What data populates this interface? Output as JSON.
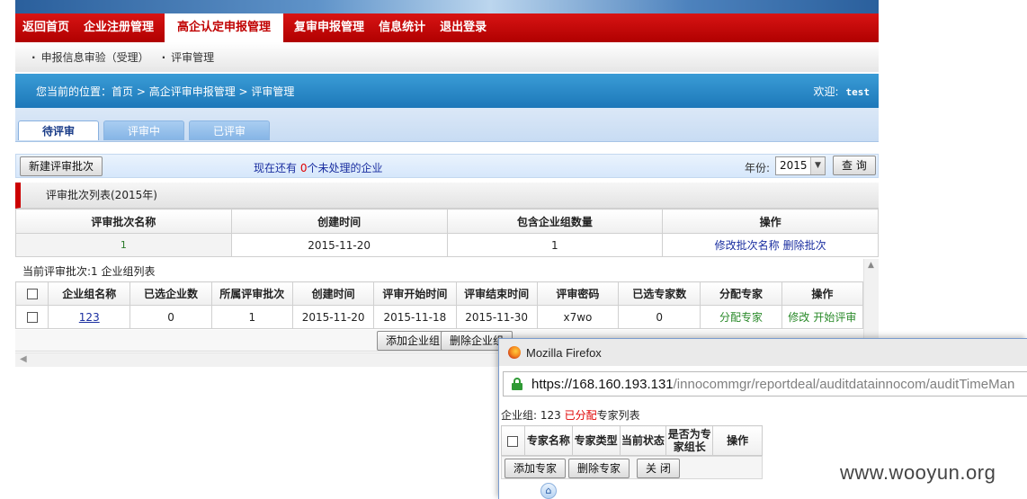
{
  "nav": {
    "items": [
      {
        "label": "返回首页",
        "active": false
      },
      {
        "label": "企业注册管理",
        "active": false
      },
      {
        "label": "高企认定申报管理",
        "active": true
      },
      {
        "label": "复审申报管理",
        "active": false
      },
      {
        "label": "信息统计",
        "active": false
      },
      {
        "label": "退出登录",
        "active": false
      }
    ],
    "sub_items": [
      "申报信息审验（受理）",
      "评审管理"
    ]
  },
  "location": {
    "prefix": "您当前的位置：",
    "crumbs": [
      "首页",
      "高企评审申报管理",
      "评审管理"
    ],
    "separator": " > ",
    "welcome_label": "欢迎:",
    "username": "test"
  },
  "tabs": [
    "待评审",
    "评审中",
    "已评审"
  ],
  "toolbar": {
    "new_batch_label": "新建评审批次",
    "pending_prefix": "现在还有 ",
    "pending_count": "0",
    "pending_suffix": "个未处理的企业",
    "year_label": "年份:",
    "year_value": "2015",
    "query_label": "查 询"
  },
  "batch": {
    "title": "评审批次列表(2015年)",
    "headers": [
      "评审批次名称",
      "创建时间",
      "包含企业组数量",
      "操作"
    ],
    "rows": [
      {
        "name": "1",
        "created": "2015-11-20",
        "group_count": "1",
        "op1": "修改批次名称",
        "op2": "删除批次"
      }
    ]
  },
  "groups": {
    "caption": "当前评审批次:1  企业组列表",
    "headers": [
      "企业组名称",
      "已选企业数",
      "所属评审批次",
      "创建时间",
      "评审开始时间",
      "评审结束时间",
      "评审密码",
      "已选专家数",
      "分配专家",
      "操作"
    ],
    "rows": [
      {
        "name": "123",
        "selected": "0",
        "batch": "1",
        "created": "2015-11-20",
        "start": "2015-11-18",
        "end": "2015-11-30",
        "password": "x7wo",
        "experts": "0",
        "assign": "分配专家",
        "op1": "修改",
        "op2": "开始评审"
      }
    ],
    "add_label": "添加企业组",
    "delete_label": "删除企业组"
  },
  "popup": {
    "window_title": "Mozilla Firefox",
    "url_host": "https://168.160.193.131",
    "url_path": "/innocommgr/reportdeal/auditdatainnocom/auditTimeMan",
    "caption_prefix": "企业组: 123  ",
    "caption_highlight": "已分配",
    "caption_suffix": "专家列表",
    "headers": [
      "专家名称",
      "专家类型",
      "当前状态",
      "是否为专家组长",
      "操作"
    ],
    "add_label": "添加专家",
    "delete_label": "删除专家",
    "close_label": "关 闭"
  },
  "watermark": "www.wooyun.org",
  "colors": {
    "nav_red": "#c80000",
    "loc_blue": "#2688c8",
    "link_blue": "#1a2ea0",
    "link_green": "#2a8a2a",
    "alert_red": "#e00000"
  }
}
